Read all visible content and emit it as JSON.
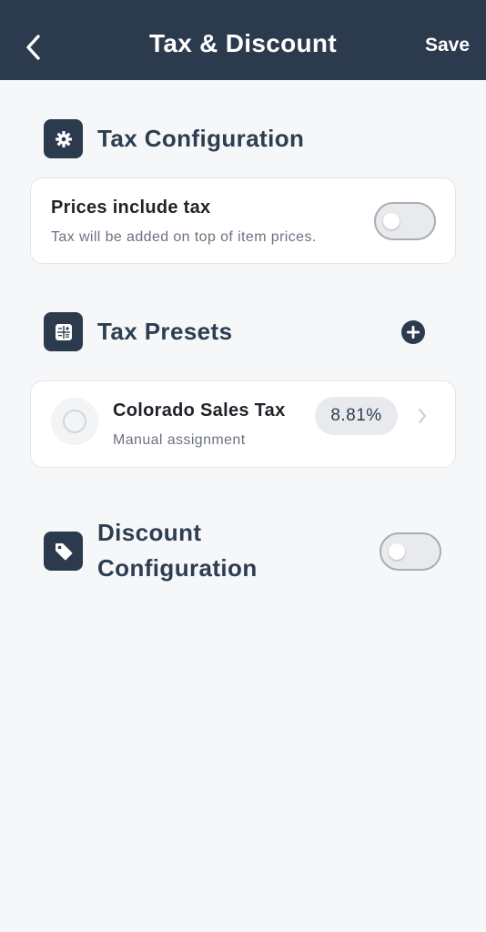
{
  "header": {
    "title": "Tax & Discount",
    "save_label": "Save",
    "back_icon": "chevron-left-icon"
  },
  "tax_configuration": {
    "title": "Tax Configuration",
    "icon": "gear-icon",
    "prices_include_tax": {
      "label": "Prices include tax",
      "description": "Tax will be added on top of item prices.",
      "enabled": false
    }
  },
  "tax_presets": {
    "title": "Tax Presets",
    "icon": "calculator-icon",
    "add_icon": "plus-circle-icon",
    "items": [
      {
        "name": "Colorado Sales Tax",
        "assignment": "Manual assignment",
        "rate": "8.81%",
        "selected": false
      }
    ]
  },
  "discount_configuration": {
    "title": "Discount Configuration",
    "icon": "tag-icon",
    "enabled": false
  },
  "colors": {
    "header_bg": "#2b3a4d",
    "page_bg": "#f6f7f9",
    "accent": "#2b3a4d",
    "text_primary": "#2c3e50",
    "text_secondary": "#6b7280"
  }
}
